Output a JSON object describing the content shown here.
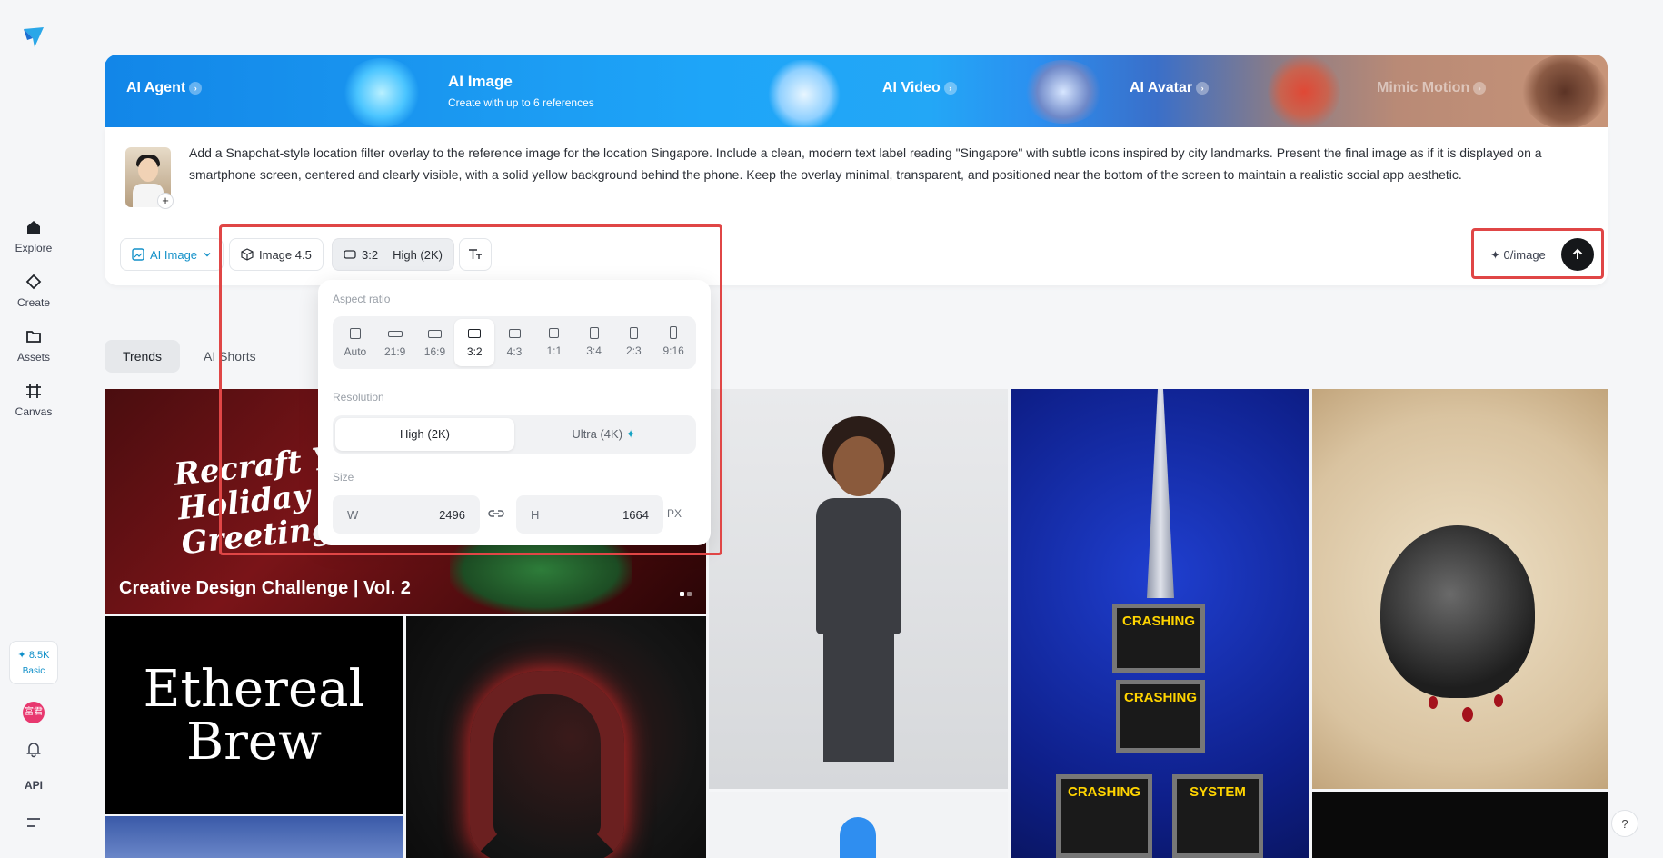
{
  "sidebar": {
    "items": [
      {
        "label": "Explore",
        "icon": "home-icon"
      },
      {
        "label": "Create",
        "icon": "diamond-icon"
      },
      {
        "label": "Assets",
        "icon": "folder-icon"
      },
      {
        "label": "Canvas",
        "icon": "canvas-icon"
      }
    ],
    "credits": "8.5K",
    "plan": "Basic",
    "avatar_text": "富君",
    "api_label": "API"
  },
  "banner": {
    "agent": "AI Agent",
    "image_title": "AI Image",
    "image_subtitle": "Create with up to 6 references",
    "video": "AI Video",
    "avatar": "AI Avatar",
    "mimic": "Mimic Motion"
  },
  "prompt": {
    "text": "Add a Snapchat-style location filter overlay to the reference image for the location Singapore. Include a clean, modern text label reading \"Singapore\" with subtle icons inspired by city landmarks. Present the final image as if it is displayed on a smartphone screen, centered and clearly visible, with a solid yellow background behind the phone. Keep the overlay minimal, transparent, and positioned near the bottom of the screen to maintain a realistic social app aesthetic."
  },
  "toolbar": {
    "mode": "AI Image",
    "model": "Image 4.5",
    "ratio": "3:2",
    "quality": "High (2K)",
    "cost": "0/image"
  },
  "popup": {
    "aspect_label": "Aspect ratio",
    "ratios": [
      "Auto",
      "21:9",
      "16:9",
      "3:2",
      "4:3",
      "1:1",
      "3:4",
      "2:3",
      "9:16"
    ],
    "selected_ratio": "3:2",
    "resolution_label": "Resolution",
    "resolutions": [
      "High (2K)",
      "Ultra (4K)"
    ],
    "selected_resolution": "High (2K)",
    "size_label": "Size",
    "width_label": "W",
    "width": "2496",
    "height_label": "H",
    "height": "1664",
    "unit": "PX"
  },
  "tabs": [
    "Trends",
    "AI Shorts"
  ],
  "gallery": {
    "featured_caption": "Creative Design Challenge | Vol. 2",
    "featured_art_text": "Recraft Your Holiday Greetings",
    "brew_text_1": "Ethereal",
    "brew_text_2": "Brew",
    "tv_labels": [
      "CRASHING",
      "CRASHING",
      "CRASHING",
      "SYSTEM"
    ]
  },
  "colors": {
    "accent": "#1491c9",
    "highlight": "#e04646",
    "send": "#15171a"
  }
}
